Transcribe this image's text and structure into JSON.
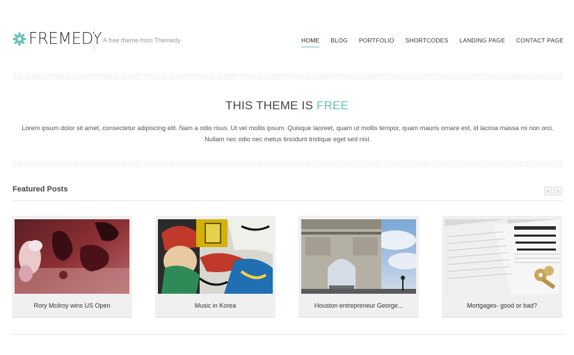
{
  "header": {
    "logo_text": "FREMEDY",
    "tagline": "A free theme from Themedy",
    "nav": [
      {
        "label": "HOME",
        "active": true
      },
      {
        "label": "BLOG"
      },
      {
        "label": "PORTFOLIO"
      },
      {
        "label": "SHORTCODES"
      },
      {
        "label": "LANDING PAGE"
      },
      {
        "label": "CONTACT PAGE"
      }
    ]
  },
  "hero": {
    "title_main": "THIS THEME IS ",
    "title_accent": "FREE",
    "text": "Lorem ipsum dolor sit amet, consectetur adipiscing elit. Nam a odio risus. Ut vel mollis ipsum. Quisque laoreet, quam ut mollis tempor, quam mauris ornare est, id lacinia massa mi non orci. Nullam nec odio nec metus tincidunt tristique eget sed nisl."
  },
  "featured": {
    "heading": "Featured Posts",
    "prev_icon": "‹",
    "next_icon": "›",
    "posts": [
      {
        "title": "Rory Mcilroy wins US Open"
      },
      {
        "title": "Music in Korea"
      },
      {
        "title": "Houston entrepreneur George..."
      },
      {
        "title": "Mortgages- good or bad?"
      }
    ]
  },
  "colors": {
    "accent": "#6fbfb6",
    "text": "#333333"
  },
  "icons": {
    "logo": "gear-icon"
  }
}
